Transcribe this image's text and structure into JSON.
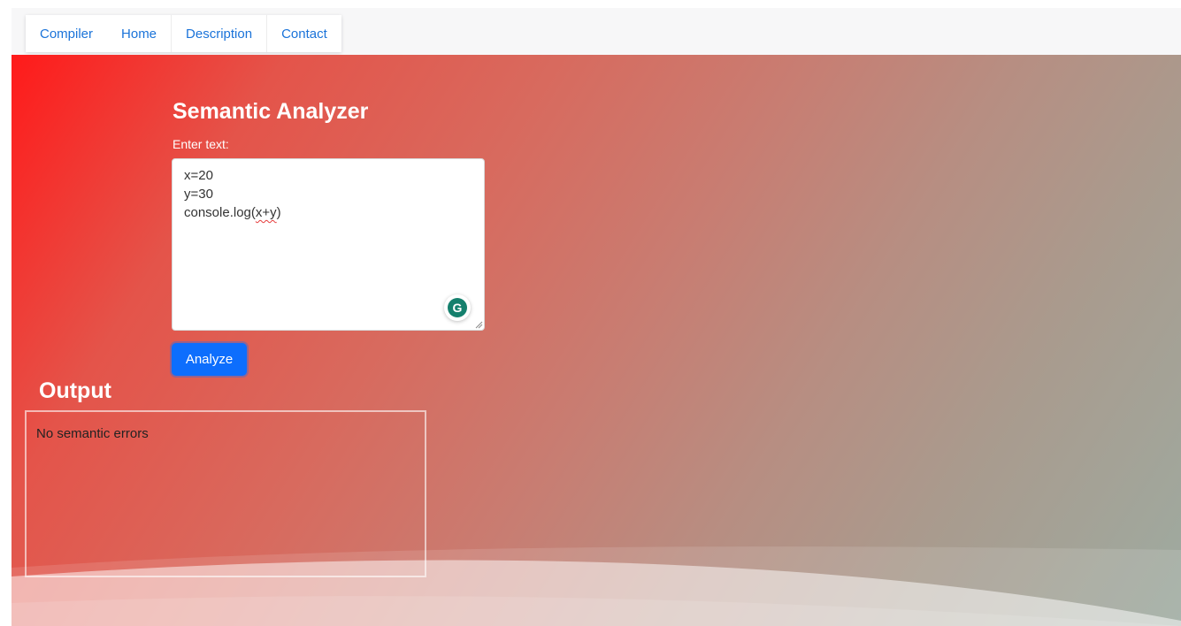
{
  "nav": {
    "items": [
      {
        "label": "Compiler"
      },
      {
        "label": "Home"
      },
      {
        "label": "Description"
      },
      {
        "label": "Contact"
      }
    ]
  },
  "main": {
    "title": "Semantic Analyzer",
    "input_label": "Enter text:",
    "code_lines": {
      "line1": "x=20",
      "line2": "y=30",
      "line3_prefix": "console.log(",
      "line3_args": "x+y",
      "line3_suffix": ")"
    },
    "analyze_label": "Analyze"
  },
  "output": {
    "title": "Output",
    "result": "No semantic errors"
  },
  "icons": {
    "grammarly": "grammarly-icon",
    "grammarly_glyph": "G",
    "resize": "resize-grip-icon"
  },
  "colors": {
    "accent": "#0d6efd",
    "nav_link": "#1a73d9",
    "gradient_start": "#ff1a1a",
    "gradient_end": "#9eaba1",
    "grammarly": "#15806d"
  }
}
